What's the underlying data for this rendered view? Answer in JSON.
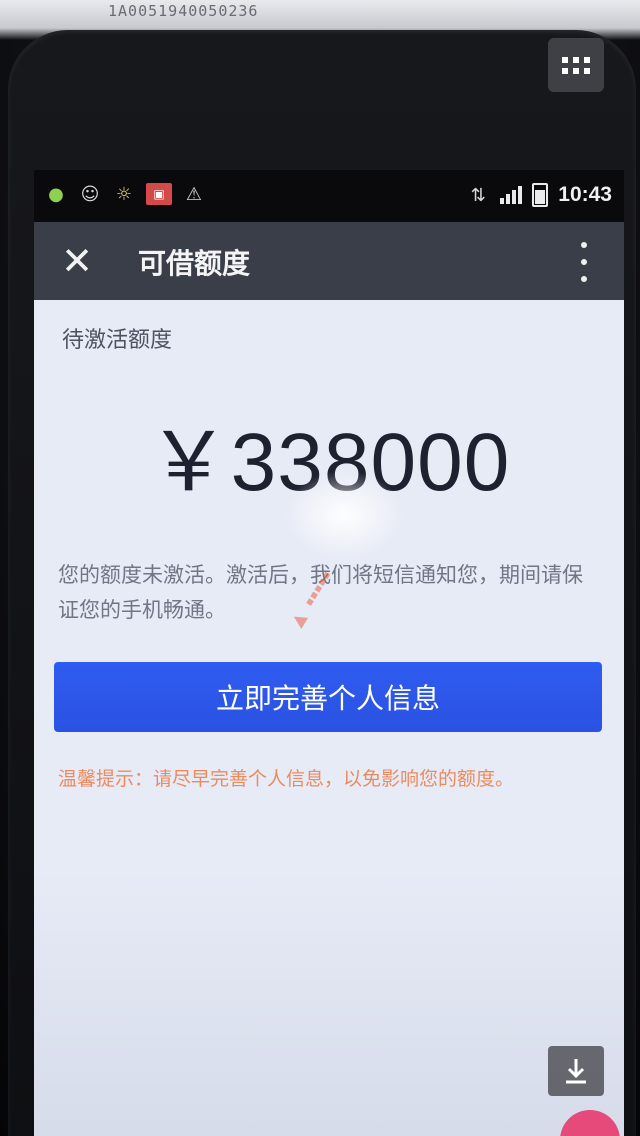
{
  "photo": {
    "paper_text": "1A0051940050236"
  },
  "status_bar": {
    "time": "10:43",
    "left_icons": [
      "wechat-icon",
      "chat-icon",
      "sun-icon",
      "notification-icon",
      "warning-icon"
    ],
    "network": "4G"
  },
  "titlebar": {
    "close_symbol": "✕",
    "title": "可借额度"
  },
  "credit": {
    "label": "待激活额度",
    "amount": "￥338000"
  },
  "description": "您的额度未激活。激活后，我们将短信通知您，期间请保证您的手机畅通。",
  "cta": {
    "label": "立即完善个人信息"
  },
  "warm_tip": "温馨提示：请尽早完善个人信息，以免影响您的额度。",
  "colors": {
    "button": "#2f5cf0",
    "titlebar": "#3a3e48",
    "warm_tip": "#ee7a45"
  }
}
